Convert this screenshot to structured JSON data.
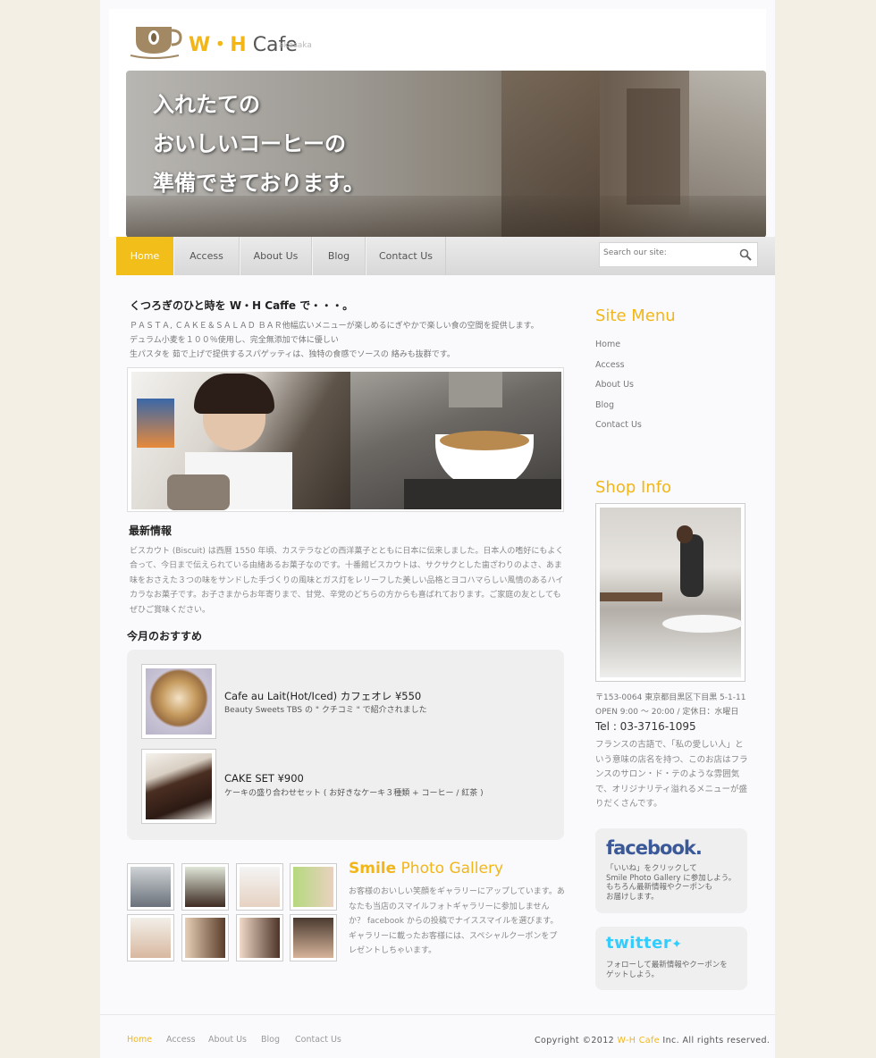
{
  "logo": {
    "text_main": "W・H",
    "text_cafe": "Cafe",
    "sub": "akasaka"
  },
  "hero": {
    "lines": [
      "入れたての",
      "おいしいコーヒーの",
      "準備できております。"
    ]
  },
  "nav": {
    "items": [
      "Home",
      "Access",
      "About Us",
      "Blog",
      "Contact Us"
    ],
    "active": "Home"
  },
  "search": {
    "placeholder": "Search our site:"
  },
  "main": {
    "title": "くつろぎのひと時を W・H Caffe で・・・。",
    "intro": [
      "ＰＡＳＴＡ, ＣＡＫＥ＆ＳＡＬＡＤ ＢＡＲ他幅広いメニューが楽しめるにぎやかで楽しい食の空間を提供します。",
      "デュラム小麦を１００％使用し、完全無添加で体に優しい",
      "生パスタを 茹で上げで提供するスパゲッティは、独特の食感でソースの 絡みも抜群です。"
    ],
    "news_heading": "最新情報",
    "news_text": "ビスカウト (Biscuit) は西暦 1550 年頃、カステラなどの西洋菓子とともに日本に伝来しました。日本人の嗜好にもよく合って、今日まで伝えられている由緒あるお菓子なのです。十番館ビスカウトは、サクサクとした歯ざわりのよさ、あま味をおさえた３つの味をサンドした手づくりの風味とガス灯をレリーフした美しい品格とヨコハマらしい風情のあるハイカラなお菓子です。お子さまからお年寄りまで、甘党、辛党のどちらの方からも喜ばれております。ご家庭の友としてもぜひご賞味ください。",
    "rec_heading": "今月のおすすめ",
    "recommendations": [
      {
        "title": "Cafe au Lait(Hot/Iced) カフェオレ ¥550",
        "desc": "Beauty Sweets TBS の \" クチコミ \" で紹介されました"
      },
      {
        "title": "CAKE SET ¥900",
        "desc": "ケーキの盛り合わせセット ( お好きなケーキ３種類 + コーヒー / 紅茶 )"
      }
    ],
    "gallery": {
      "title_bold": "Smile",
      "title_rest": " Photo Gallery",
      "text": "お客様のおいしい笑顔をギャラリーにアップしています。あなたも当店のスマイルフォトギャラリーに参加しませんか？ facebook からの投稿でナイススマイルを選びます。ギャラリーに載ったお客様には、スペシャルクーポンをプレゼントしちゃいます。"
    }
  },
  "sidebar": {
    "menu_heading": "Site Menu",
    "menu_items": [
      "Home",
      "Access",
      "About Us",
      "Blog",
      "Contact Us"
    ],
    "shop_heading": "Shop Info",
    "address": "〒153-0064 東京都目黒区下目黒 5-1-11",
    "hours": "OPEN 9:00 〜 20:00 / 定休日：水曜日",
    "tel": "Tel : 03-3716-1095",
    "desc": "フランスの古語で、「私の愛しい人」という意味の店名を持つ、このお店はフランスのサロン・ド・テのような雰囲気で、オリジナリティ溢れるメニューが盛りだくさんです。",
    "facebook": {
      "logo": "facebook.",
      "text": [
        "「いいね」をクリックして",
        "Smile Photo Gallery  に参加しよう。",
        "もちろん最新情報やクーポンも",
        "お届けします。"
      ]
    },
    "twitter": {
      "logo": "twitter",
      "text": [
        "フォローして最新情報やクーポンを",
        "ゲットしよう。"
      ]
    }
  },
  "footer": {
    "nav": [
      "Home",
      "Access",
      "About Us",
      "Blog",
      "Contact Us"
    ],
    "copy_pre": "Copyright ©2012 ",
    "copy_brand": "W-H Cafe",
    "copy_post": " Inc. All rights reserved."
  },
  "colors": {
    "accent": "#f2b618",
    "facebook": "#3b5998",
    "twitter": "#33ccff"
  }
}
